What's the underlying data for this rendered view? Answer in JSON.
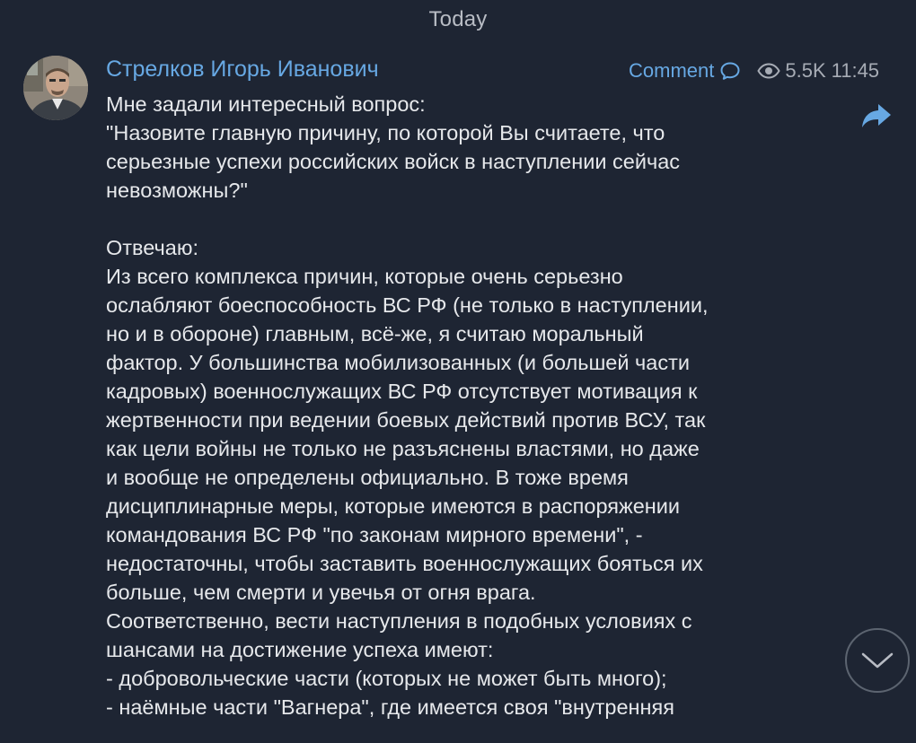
{
  "date_separator": "Today",
  "post": {
    "author": "Стрелков Игорь Иванович",
    "comment_label": "Comment",
    "views": "5.5K",
    "time": "11:45",
    "lines": [
      "Мне задали интересный вопрос:",
      "\"Назовите главную причину, по которой Вы считаете, что",
      "серьезные успехи российских войск в наступлении сейчас",
      "невозможны?\"",
      "",
      "Отвечаю:",
      "Из всего комплекса причин, которые очень серьезно",
      "ослабляют боеспособность ВС РФ (не только в наступлении,",
      "но и в обороне) главным, всё-же, я считаю моральный",
      "фактор. У большинства мобилизованных (и большей части",
      "кадровых) военнослужащих ВС РФ отсутствует мотивация к",
      "жертвенности при ведении боевых действий против ВСУ, так",
      "как цели войны не только не разъяснены властями, но даже",
      "и вообще не определены официально. В тоже время",
      "дисциплинарные меры, которые имеются в распоряжении",
      "командования ВС РФ \"по законам мирного времени\", -",
      "недостаточны, чтобы заставить военнослужащих бояться их",
      "больше, чем смерти и увечья от огня врага.",
      "Соответственно, вести наступления в подобных условиях с",
      "шансами на достижение успеха имеют:",
      "- добровольческие части (которых не может быть много);",
      "- наёмные части \"Вагнера\", где имеется своя \"внутренняя"
    ]
  },
  "icons": {
    "comment": "speech-bubble-icon",
    "views": "eye-icon",
    "forward": "forward-arrow-icon",
    "scroll_down": "chevron-down-icon"
  },
  "colors": {
    "background": "#1e2533",
    "accent": "#67a8e3",
    "text": "#e6e8eb",
    "muted": "#a7acb5"
  }
}
